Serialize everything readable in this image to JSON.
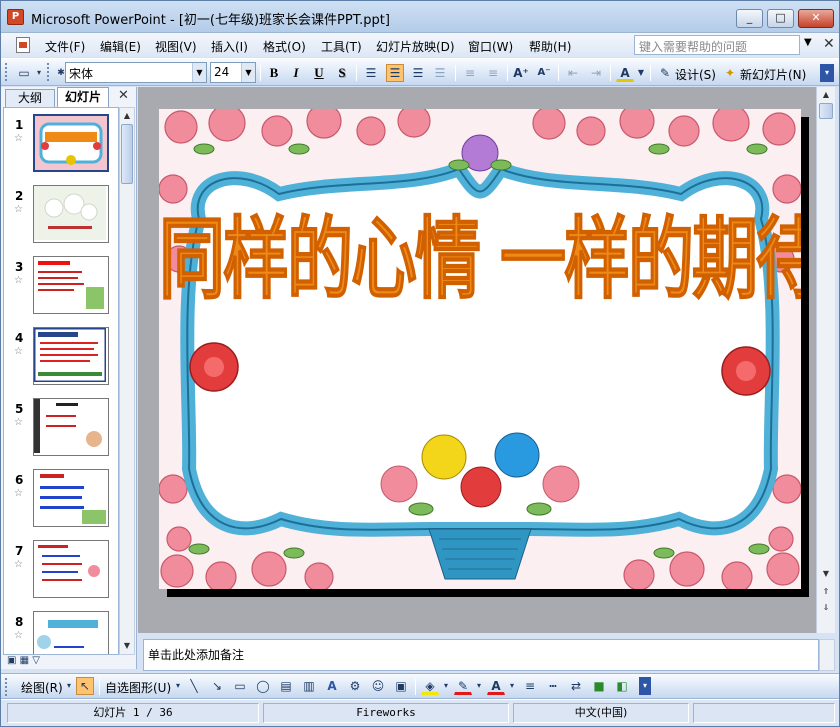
{
  "window": {
    "title": "Microsoft PowerPoint - [初一(七年级)班家长会课件PPT.ppt]",
    "controls": {
      "minimize": "_",
      "maximize": "□",
      "close": "✕"
    }
  },
  "menubar": {
    "items": [
      "文件(F)",
      "编辑(E)",
      "视图(V)",
      "插入(I)",
      "格式(O)",
      "工具(T)",
      "幻灯片放映(D)",
      "窗口(W)",
      "帮助(H)"
    ],
    "help_placeholder": "键入需要帮助的问题",
    "close_glyph": "✕"
  },
  "format_toolbar": {
    "font_name": "宋体",
    "font_size": "24",
    "bold": "B",
    "italic": "I",
    "underline": "U",
    "shadow": "S",
    "design_label": "设计(S)",
    "new_slide_label": "新幻灯片(N)"
  },
  "left_pane": {
    "tab_outline": "大纲",
    "tab_slides": "幻灯片",
    "close_glyph": "✕",
    "slides": [
      {
        "num": "1",
        "selected": true
      },
      {
        "num": "2",
        "selected": false
      },
      {
        "num": "3",
        "selected": false
      },
      {
        "num": "4",
        "selected": false
      },
      {
        "num": "5",
        "selected": false
      },
      {
        "num": "6",
        "selected": false
      },
      {
        "num": "7",
        "selected": false
      },
      {
        "num": "8",
        "selected": false
      }
    ],
    "star_glyph": "☆"
  },
  "slide": {
    "title": "同样的心情 一样的期待"
  },
  "notes": {
    "placeholder": "单击此处添加备注"
  },
  "draw_toolbar": {
    "draw_label": "绘图(R)",
    "autoshapes_label": "自选图形(U)"
  },
  "status_bar": {
    "slide_position": "幻灯片 1 / 36",
    "design_name": "Fireworks",
    "language": "中文(中国)"
  },
  "colors": {
    "title_orange": "#f08a16",
    "accent_blue": "#27458b",
    "frame_blue": "#4fb1d8",
    "rose_pink": "#f08c9b"
  }
}
